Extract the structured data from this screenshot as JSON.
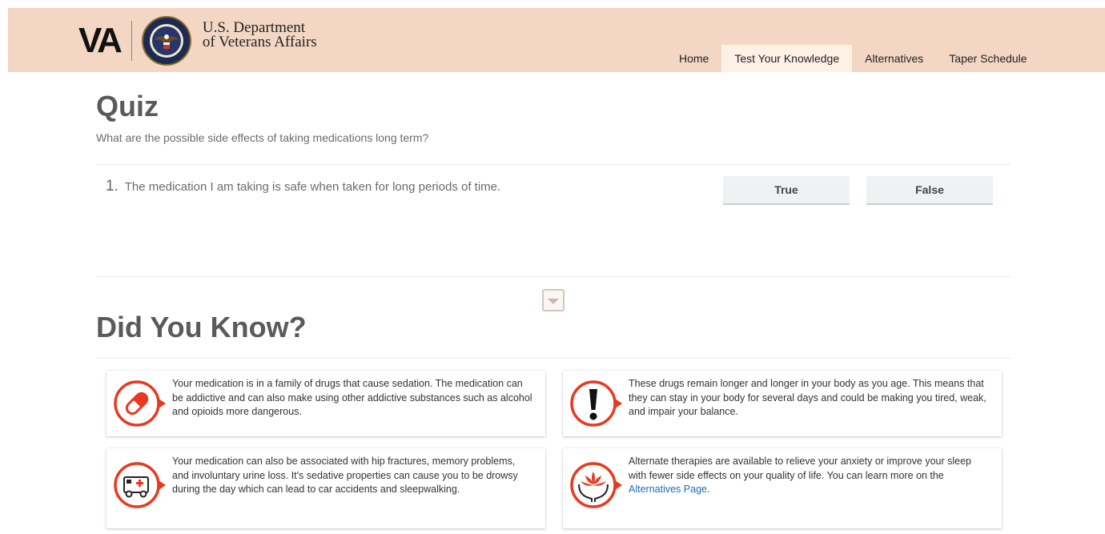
{
  "header": {
    "logo_mark": "VA",
    "department_line1": "U.S. Department",
    "department_line2": "of Veterans Affairs",
    "nav": [
      {
        "label": "Home",
        "active": false
      },
      {
        "label": "Test Your Knowledge",
        "active": true
      },
      {
        "label": "Alternatives",
        "active": false
      },
      {
        "label": "Taper Schedule",
        "active": false
      }
    ]
  },
  "quiz": {
    "title": "Quiz",
    "subtitle": "What are the possible side effects of taking medications long term?",
    "question_number": "1.",
    "question_text": "The medication I am taking is safe when taken for long periods of time.",
    "true_label": "True",
    "false_label": "False"
  },
  "did_you_know": {
    "title": "Did You Know?",
    "cards": [
      {
        "icon": "pill-icon",
        "text": "Your medication is in a family of drugs that cause sedation. The medication can be addictive and can also make using other addictive substances such as alcohol and opioids more dangerous."
      },
      {
        "icon": "exclamation-icon",
        "text": "These drugs remain longer and longer in your body as you age. This means that they can stay in your body for several days and could be making you tired, weak, and impair your balance."
      },
      {
        "icon": "ambulance-icon",
        "text": "Your medication can also be associated with hip fractures, memory problems, and involuntary urine loss. It's sedative properties can cause you to be drowsy during the day which can lead to car accidents and sleepwalking."
      },
      {
        "icon": "lotus-hands-icon",
        "text_before": "Alternate therapies are available to relieve your anxiety or improve your sleep with fewer side effects on your quality of life. You can learn more on the ",
        "link_text": "Alternatives Page",
        "text_after": "."
      }
    ]
  },
  "colors": {
    "header_bg": "#f3d7c4",
    "icon_red": "#e8391f",
    "link_blue": "#1b6cb5"
  }
}
